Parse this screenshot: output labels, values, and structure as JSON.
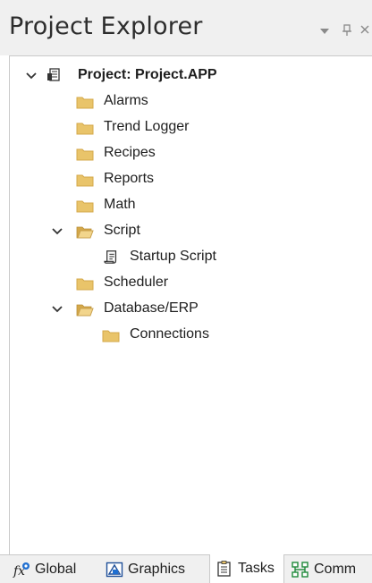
{
  "panel": {
    "title": "Project Explorer",
    "controls": {
      "menu": "▾",
      "pin": "ᵠ",
      "close": "×"
    }
  },
  "tree": {
    "root": "Project: Project.APP",
    "items": [
      {
        "label": "Alarms",
        "icon": "folder-icon"
      },
      {
        "label": "Trend Logger",
        "icon": "folder-icon"
      },
      {
        "label": "Recipes",
        "icon": "folder-icon"
      },
      {
        "label": "Reports",
        "icon": "folder-icon"
      },
      {
        "label": "Math",
        "icon": "folder-icon"
      },
      {
        "label": "Script",
        "icon": "folder-open-icon",
        "expanded": true
      },
      {
        "label": "Startup Script",
        "icon": "script-icon"
      },
      {
        "label": "Scheduler",
        "icon": "folder-icon"
      },
      {
        "label": "Database/ERP",
        "icon": "folder-open-icon",
        "expanded": true
      },
      {
        "label": "Connections",
        "icon": "folder-icon"
      }
    ]
  },
  "tabs": [
    {
      "label": "Global",
      "icon": "fx-icon"
    },
    {
      "label": "Graphics",
      "icon": "graphics-icon"
    },
    {
      "label": "Tasks",
      "icon": "tasks-icon",
      "active": true
    },
    {
      "label": "Comm",
      "icon": "comm-icon"
    }
  ],
  "colors": {
    "folder": "#e9c46a",
    "folder_dark": "#d4a84a",
    "accent_blue": "#1f6fd1",
    "chrome": "#f0f0f0"
  }
}
